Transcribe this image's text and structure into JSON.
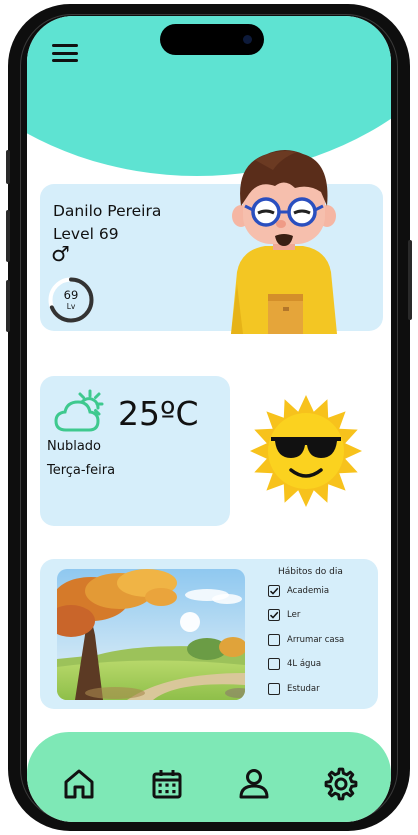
{
  "colors": {
    "header_teal": "#5ee3d2",
    "card_blue": "#d6eefa",
    "nav_green": "#7ee8b6",
    "weather_icon_green": "#3ec98e",
    "ring_dark": "#333333"
  },
  "header": {
    "menu_icon": "hamburger-menu-icon"
  },
  "profile": {
    "name": "Danilo Pereira",
    "level_text": "Level 69",
    "gender_symbol": "♂",
    "ring_value": "69",
    "ring_unit": "Lv",
    "ring_progress": 0.69
  },
  "weather": {
    "icon": "sun-cloud-icon",
    "temperature": "25ºC",
    "condition": "Nublado",
    "weekday": "Terça-feira"
  },
  "habits": {
    "title": "Hábitos do dia",
    "items": [
      {
        "label": "Academia",
        "checked": true
      },
      {
        "label": "Ler",
        "checked": true
      },
      {
        "label": "Arrumar casa",
        "checked": false
      },
      {
        "label": "4L água",
        "checked": false
      },
      {
        "label": "Estudar",
        "checked": false
      }
    ]
  },
  "nav": {
    "items": [
      {
        "icon": "home-icon"
      },
      {
        "icon": "calendar-icon"
      },
      {
        "icon": "user-icon"
      },
      {
        "icon": "settings-gear-icon"
      }
    ]
  }
}
